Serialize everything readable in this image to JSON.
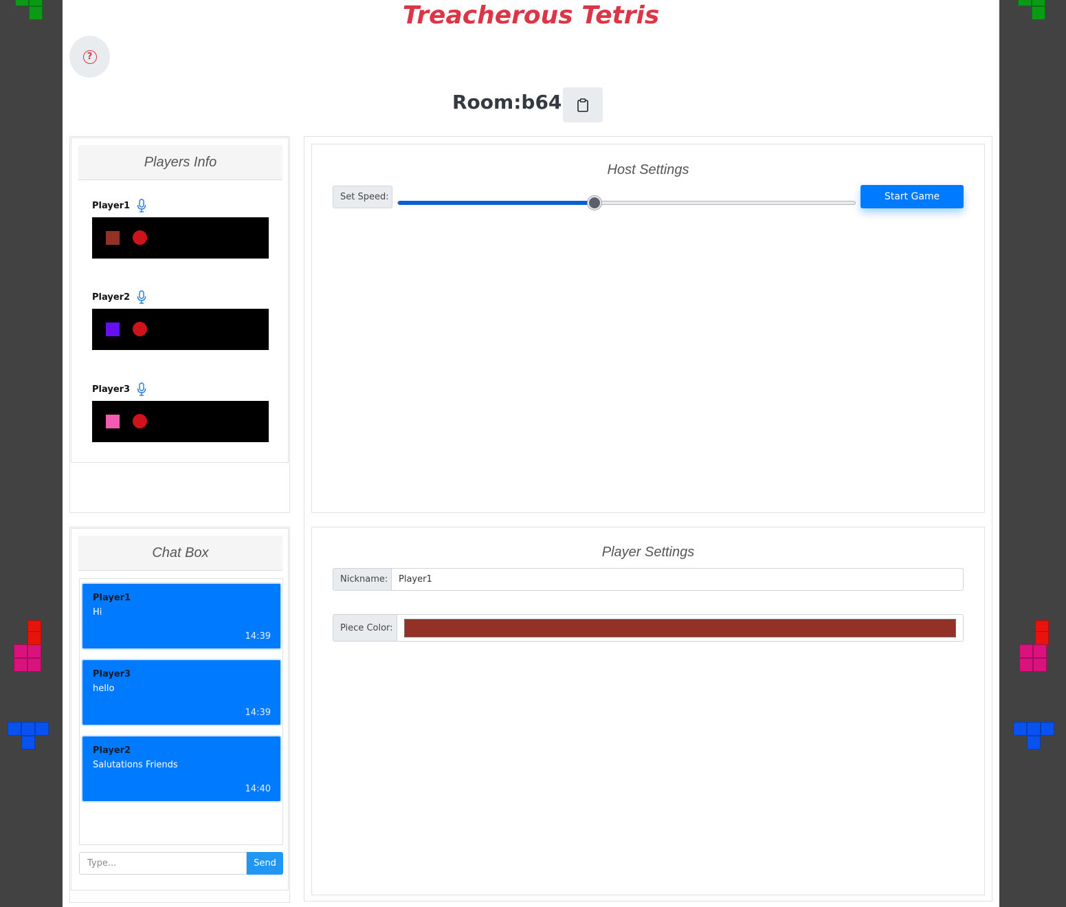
{
  "app": {
    "title": "Treacherous Tetris"
  },
  "room": {
    "label": "Room:b645"
  },
  "players_info": {
    "title": "Players Info",
    "players": [
      {
        "name": "Player1",
        "color": "#943126"
      },
      {
        "name": "Player2",
        "color": "#6610f2"
      },
      {
        "name": "Player3",
        "color": "#f35bb3"
      }
    ]
  },
  "chat": {
    "title": "Chat Box",
    "messages": [
      {
        "name": "Player1",
        "text": "Hi",
        "time": "14:39"
      },
      {
        "name": "Player3",
        "text": "hello",
        "time": "14:39"
      },
      {
        "name": "Player2",
        "text": "Salutations Friends",
        "time": "14:40"
      }
    ],
    "input_placeholder": "Type...",
    "send_label": "Send"
  },
  "host_settings": {
    "title": "Host Settings",
    "speed_label": "Set Speed:",
    "speed_value_fraction": 0.43,
    "start_label": "Start Game"
  },
  "player_settings": {
    "title": "Player Settings",
    "nickname_label": "Nickname:",
    "nickname_value": "Player1",
    "piece_color_label": "Piece Color:",
    "piece_color": "#943126"
  },
  "colors": {
    "title_red": "#dc3545",
    "accent_blue": "#007bff",
    "border_gray": "#424242"
  }
}
